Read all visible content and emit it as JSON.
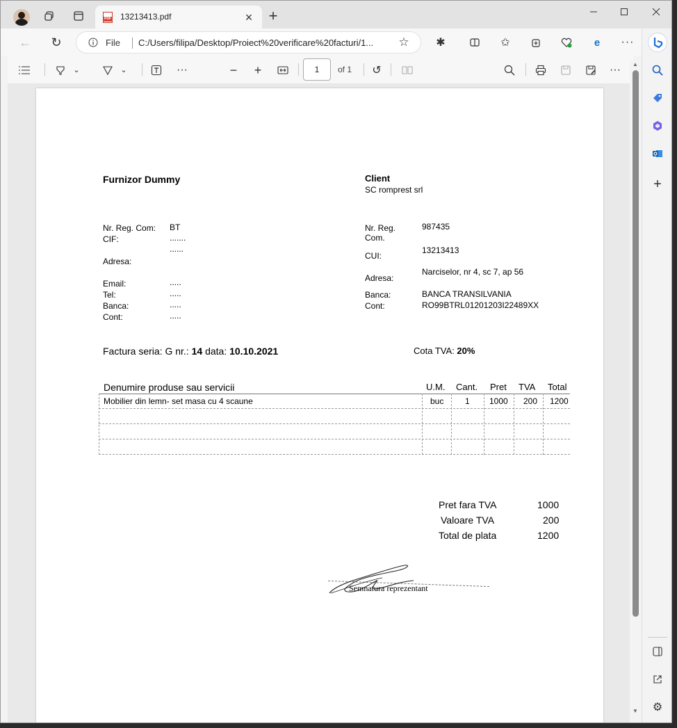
{
  "browser": {
    "tab_title": "13213413.pdf",
    "file_label": "File",
    "url": "C:/Users/filipa/Desktop/Proiect%20verificare%20facturi/1..."
  },
  "pdf_toolbar": {
    "page_number": "1",
    "page_total": "of 1"
  },
  "invoice": {
    "supplier": {
      "title": "Furnizor Dummy",
      "reg_label": "Nr. Reg. Com:",
      "reg_value": "BT",
      "cif_label": "CIF:",
      "cif_value": ".......",
      "cif_value2": "......",
      "address_label": "Adresa:",
      "email_label": "Email:",
      "email_value": ".....",
      "tel_label": "Tel:",
      "tel_value": ".....",
      "bank_label": "Banca:",
      "bank_value": ".....",
      "account_label": "Cont:",
      "account_value": "....."
    },
    "client": {
      "title": "Client",
      "name": "SC romprest srl",
      "reg_label_1": "Nr. Reg.",
      "reg_label_2": "Com.",
      "reg_value": "987435",
      "cui_label": "CUI:",
      "cui_value": "13213413",
      "address_label": "Adresa:",
      "address_value": "Narciselor, nr 4, sc 7, ap 56",
      "bank_label": "Banca:",
      "bank_value": "BANCA TRANSILVANIA",
      "account_label": "Cont:",
      "account_value": "RO99BTRL01201203I22489XX"
    },
    "header_line": {
      "prefix": "Factura seria: G  nr.: ",
      "number": "14",
      "date_label": " data: ",
      "date": "10.10.2021",
      "vat_label": "Cota TVA: ",
      "vat_rate": "20%"
    },
    "table": {
      "headers": [
        "Denumire produse sau servicii",
        "U.M.",
        "Cant.",
        "Pret",
        "TVA",
        "Total"
      ],
      "rows": [
        [
          "Mobilier din lemn- set masa cu 4 scaune",
          "buc",
          "1",
          "1000",
          "200",
          "1200"
        ]
      ]
    },
    "totals": {
      "net_label": "Pret fara TVA",
      "net_value": "1000",
      "vat_label": "Valoare TVA",
      "vat_value": "200",
      "total_label": "Total de plata",
      "total_value": "1200"
    },
    "signature_label": "Semnatura reprezentant"
  }
}
